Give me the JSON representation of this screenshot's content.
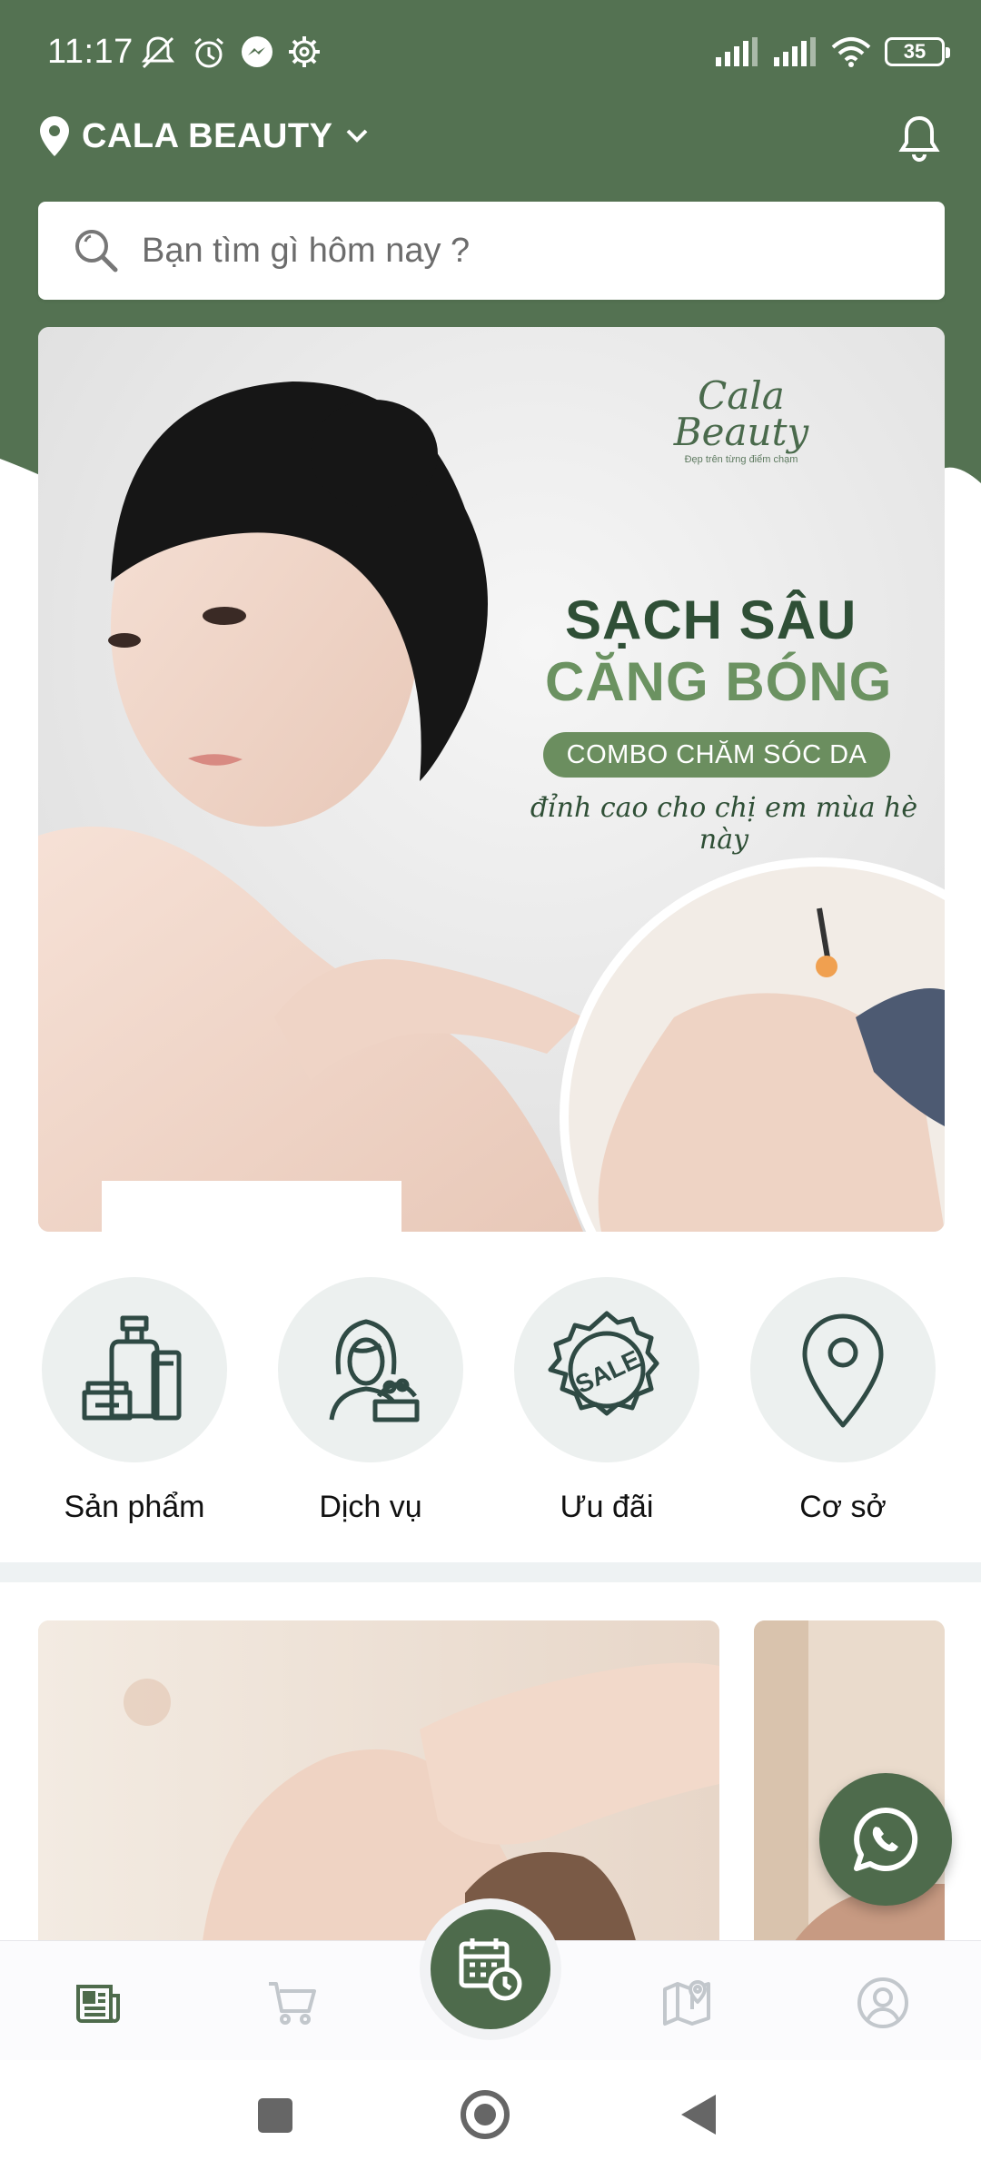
{
  "status_bar": {
    "time": "11:17",
    "battery": "35"
  },
  "header": {
    "location": "CALA BEAUTY",
    "search_placeholder": "Bạn tìm gì hôm nay ?"
  },
  "banner": {
    "logo_line1": "Cala",
    "logo_line2": "Beauty",
    "logo_tagline": "Đẹp trên từng điểm chạm",
    "headline_1": "SẠCH SÂU",
    "headline_2": "CĂNG BÓNG",
    "pill": "COMBO CHĂM SÓC DA",
    "script": "đỉnh cao cho chị em mùa hè này"
  },
  "categories": [
    {
      "label": "Sản phẩm",
      "icon": "cosmetics-icon"
    },
    {
      "label": "Dịch vụ",
      "icon": "service-icon"
    },
    {
      "label": "Ưu đãi",
      "icon": "sale-badge-icon"
    },
    {
      "label": "Cơ sở",
      "icon": "map-pin-icon"
    }
  ],
  "colors": {
    "brand_green": "#4e6b4c",
    "header_green": "#547252",
    "light_circle": "#ecf0ef"
  },
  "bottom_nav": [
    {
      "name": "news",
      "icon": "newspaper-icon",
      "active": true
    },
    {
      "name": "cart",
      "icon": "cart-icon",
      "active": false
    },
    {
      "name": "booking",
      "icon": "calendar-clock-icon",
      "active": false
    },
    {
      "name": "map",
      "icon": "map-icon",
      "active": false
    },
    {
      "name": "profile",
      "icon": "user-circle-icon",
      "active": false
    }
  ]
}
